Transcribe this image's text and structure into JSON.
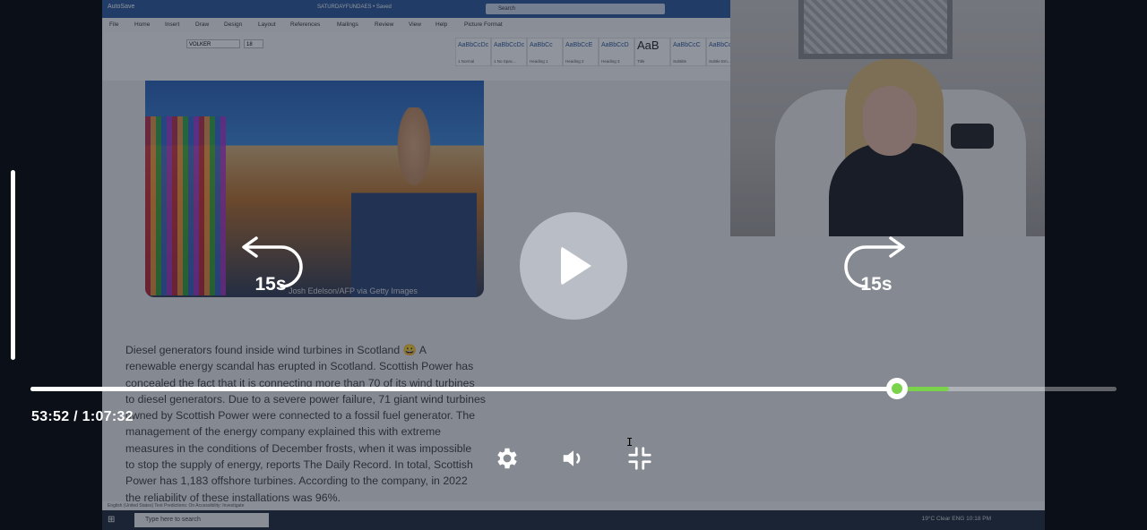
{
  "word": {
    "app_label": "AutoSave",
    "doc_name": "SATURDAYFUNDAES • Saved",
    "search_placeholder": "Search",
    "tabs": [
      "File",
      "Home",
      "Insert",
      "Draw",
      "Design",
      "Layout",
      "References",
      "Mailings",
      "Review",
      "View",
      "Help",
      "Picture Format"
    ],
    "font_name": "VOLKER",
    "font_size": "18",
    "styles": [
      {
        "sample": "AaBbCcDc",
        "name": "1 Normal"
      },
      {
        "sample": "AaBbCcDc",
        "name": "1 No Spac..."
      },
      {
        "sample": "AaBbCc",
        "name": "Heading 1"
      },
      {
        "sample": "AaBbCcE",
        "name": "Heading 2"
      },
      {
        "sample": "AaBbCcD",
        "name": "Heading 3"
      },
      {
        "sample": "AaB",
        "name": "Title"
      },
      {
        "sample": "AaBbCcC",
        "name": "Subtitle"
      },
      {
        "sample": "AaBbCcDc",
        "name": "Subtle Em..."
      }
    ],
    "photo_credit": "Josh Edelson/AFP via Getty Images",
    "body_lines": [
      "Diesel generators found inside wind turbines in Scotland 😀 A",
      "renewable energy scandal has erupted in Scotland. Scottish Power has",
      "concealed the fact that it is connecting more than 70 of its wind turbines",
      "to diesel generators. Due to a severe power failure, 71 giant wind turbines",
      "owned by Scottish Power were connected to a fossil fuel generator. The",
      "management of the energy company explained this with extreme",
      "measures in the conditions of December frosts, when it was impossible",
      "to stop the supply of energy, reports The Daily Record. In total, Scottish",
      "Power has 1,183 offshore turbines. According to the company, in 2022",
      "the reliability of these installations was 96%."
    ],
    "statusbar": "English (United States)   Text Predictions: On   Accessibility: Investigate",
    "taskbar_search": "Type here to search",
    "tray": "19°C  Clear   ENG   10:18 PM"
  },
  "player": {
    "rewind_label": "15s",
    "forward_label": "15s",
    "current_time": "53:52",
    "duration": "1:07:32",
    "time_display": "53:52 / 1:07:32",
    "progress_played": 0.7975,
    "progress_buffered": 0.846,
    "accent_color": "#7bd24b"
  },
  "icons": {
    "play": "play-icon",
    "rewind": "rewind-15-icon",
    "forward": "forward-15-icon",
    "settings": "gear-icon",
    "volume": "speaker-icon",
    "fullscreen": "exit-fullscreen-icon"
  }
}
